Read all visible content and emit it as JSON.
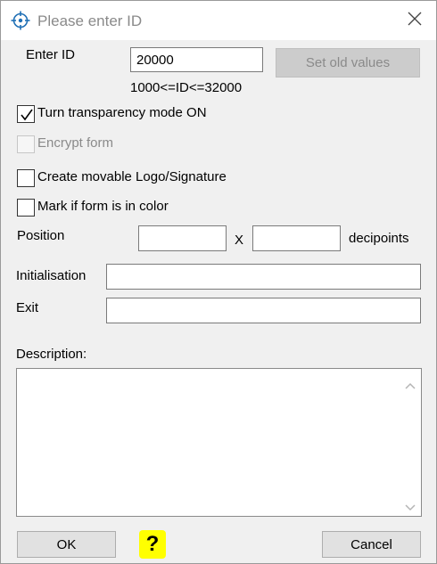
{
  "window": {
    "title": "Please enter ID"
  },
  "id_section": {
    "label": "Enter ID",
    "value": "20000",
    "hint": "1000<=ID<=32000",
    "set_old_values_label": "Set old values"
  },
  "checkboxes": [
    {
      "label": "Turn transparency mode ON",
      "checked": true,
      "enabled": true
    },
    {
      "label": "Encrypt form",
      "checked": false,
      "enabled": false
    },
    {
      "label": "Create movable Logo/Signature",
      "checked": false,
      "enabled": true
    },
    {
      "label": "Mark if form is in color",
      "checked": false,
      "enabled": true
    }
  ],
  "position": {
    "label": "Position",
    "x_value": "",
    "separator": "X",
    "y_value": "",
    "unit": "decipoints"
  },
  "initialisation": {
    "label": "Initialisation",
    "value": ""
  },
  "exit": {
    "label": "Exit",
    "value": ""
  },
  "description": {
    "label": "Description:",
    "value": ""
  },
  "buttons": {
    "ok": "OK",
    "help": "?",
    "cancel": "Cancel"
  },
  "icons": {
    "app": "crosshair-target-icon",
    "close": "close-icon",
    "help": "question-mark-icon"
  },
  "colors": {
    "help_bg": "#ffff00",
    "app_icon": "#1f6fb5",
    "title_text": "#8a8a8a"
  }
}
